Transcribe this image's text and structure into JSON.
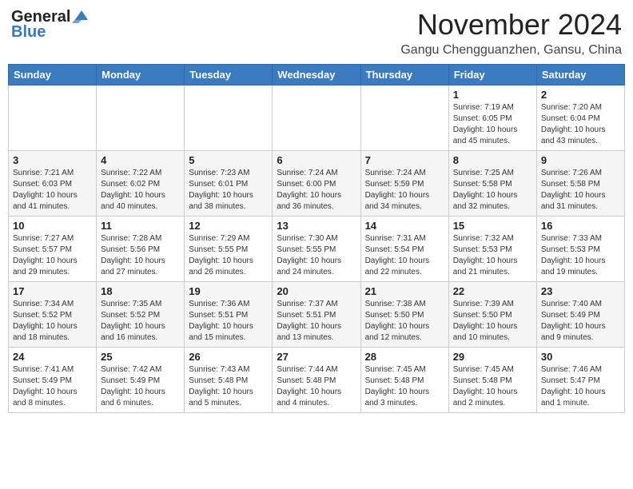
{
  "header": {
    "logo_line1": "General",
    "logo_line2": "Blue",
    "month": "November 2024",
    "location": "Gangu Chengguanzhen, Gansu, China"
  },
  "weekdays": [
    "Sunday",
    "Monday",
    "Tuesday",
    "Wednesday",
    "Thursday",
    "Friday",
    "Saturday"
  ],
  "weeks": [
    [
      {
        "day": "",
        "info": ""
      },
      {
        "day": "",
        "info": ""
      },
      {
        "day": "",
        "info": ""
      },
      {
        "day": "",
        "info": ""
      },
      {
        "day": "",
        "info": ""
      },
      {
        "day": "1",
        "info": "Sunrise: 7:19 AM\nSunset: 6:05 PM\nDaylight: 10 hours\nand 45 minutes."
      },
      {
        "day": "2",
        "info": "Sunrise: 7:20 AM\nSunset: 6:04 PM\nDaylight: 10 hours\nand 43 minutes."
      }
    ],
    [
      {
        "day": "3",
        "info": "Sunrise: 7:21 AM\nSunset: 6:03 PM\nDaylight: 10 hours\nand 41 minutes."
      },
      {
        "day": "4",
        "info": "Sunrise: 7:22 AM\nSunset: 6:02 PM\nDaylight: 10 hours\nand 40 minutes."
      },
      {
        "day": "5",
        "info": "Sunrise: 7:23 AM\nSunset: 6:01 PM\nDaylight: 10 hours\nand 38 minutes."
      },
      {
        "day": "6",
        "info": "Sunrise: 7:24 AM\nSunset: 6:00 PM\nDaylight: 10 hours\nand 36 minutes."
      },
      {
        "day": "7",
        "info": "Sunrise: 7:24 AM\nSunset: 5:59 PM\nDaylight: 10 hours\nand 34 minutes."
      },
      {
        "day": "8",
        "info": "Sunrise: 7:25 AM\nSunset: 5:58 PM\nDaylight: 10 hours\nand 32 minutes."
      },
      {
        "day": "9",
        "info": "Sunrise: 7:26 AM\nSunset: 5:58 PM\nDaylight: 10 hours\nand 31 minutes."
      }
    ],
    [
      {
        "day": "10",
        "info": "Sunrise: 7:27 AM\nSunset: 5:57 PM\nDaylight: 10 hours\nand 29 minutes."
      },
      {
        "day": "11",
        "info": "Sunrise: 7:28 AM\nSunset: 5:56 PM\nDaylight: 10 hours\nand 27 minutes."
      },
      {
        "day": "12",
        "info": "Sunrise: 7:29 AM\nSunset: 5:55 PM\nDaylight: 10 hours\nand 26 minutes."
      },
      {
        "day": "13",
        "info": "Sunrise: 7:30 AM\nSunset: 5:55 PM\nDaylight: 10 hours\nand 24 minutes."
      },
      {
        "day": "14",
        "info": "Sunrise: 7:31 AM\nSunset: 5:54 PM\nDaylight: 10 hours\nand 22 minutes."
      },
      {
        "day": "15",
        "info": "Sunrise: 7:32 AM\nSunset: 5:53 PM\nDaylight: 10 hours\nand 21 minutes."
      },
      {
        "day": "16",
        "info": "Sunrise: 7:33 AM\nSunset: 5:53 PM\nDaylight: 10 hours\nand 19 minutes."
      }
    ],
    [
      {
        "day": "17",
        "info": "Sunrise: 7:34 AM\nSunset: 5:52 PM\nDaylight: 10 hours\nand 18 minutes."
      },
      {
        "day": "18",
        "info": "Sunrise: 7:35 AM\nSunset: 5:52 PM\nDaylight: 10 hours\nand 16 minutes."
      },
      {
        "day": "19",
        "info": "Sunrise: 7:36 AM\nSunset: 5:51 PM\nDaylight: 10 hours\nand 15 minutes."
      },
      {
        "day": "20",
        "info": "Sunrise: 7:37 AM\nSunset: 5:51 PM\nDaylight: 10 hours\nand 13 minutes."
      },
      {
        "day": "21",
        "info": "Sunrise: 7:38 AM\nSunset: 5:50 PM\nDaylight: 10 hours\nand 12 minutes."
      },
      {
        "day": "22",
        "info": "Sunrise: 7:39 AM\nSunset: 5:50 PM\nDaylight: 10 hours\nand 10 minutes."
      },
      {
        "day": "23",
        "info": "Sunrise: 7:40 AM\nSunset: 5:49 PM\nDaylight: 10 hours\nand 9 minutes."
      }
    ],
    [
      {
        "day": "24",
        "info": "Sunrise: 7:41 AM\nSunset: 5:49 PM\nDaylight: 10 hours\nand 8 minutes."
      },
      {
        "day": "25",
        "info": "Sunrise: 7:42 AM\nSunset: 5:49 PM\nDaylight: 10 hours\nand 6 minutes."
      },
      {
        "day": "26",
        "info": "Sunrise: 7:43 AM\nSunset: 5:48 PM\nDaylight: 10 hours\nand 5 minutes."
      },
      {
        "day": "27",
        "info": "Sunrise: 7:44 AM\nSunset: 5:48 PM\nDaylight: 10 hours\nand 4 minutes."
      },
      {
        "day": "28",
        "info": "Sunrise: 7:45 AM\nSunset: 5:48 PM\nDaylight: 10 hours\nand 3 minutes."
      },
      {
        "day": "29",
        "info": "Sunrise: 7:45 AM\nSunset: 5:48 PM\nDaylight: 10 hours\nand 2 minutes."
      },
      {
        "day": "30",
        "info": "Sunrise: 7:46 AM\nSunset: 5:47 PM\nDaylight: 10 hours\nand 1 minute."
      }
    ]
  ]
}
